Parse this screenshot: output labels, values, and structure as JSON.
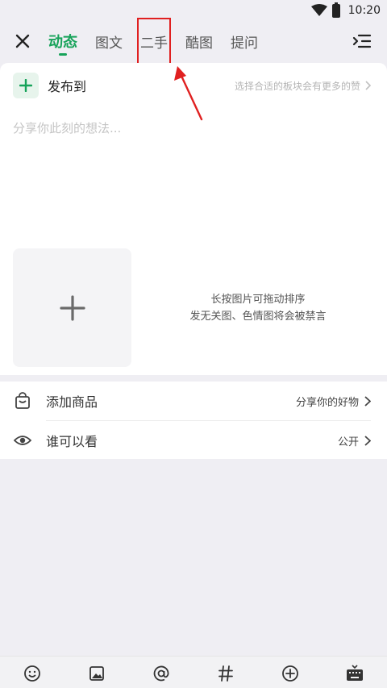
{
  "status_bar": {
    "time": "10:20"
  },
  "tabs": [
    {
      "label": "动态",
      "active": true
    },
    {
      "label": "图文",
      "active": false
    },
    {
      "label": "二手",
      "active": false,
      "highlighted": true
    },
    {
      "label": "酷图",
      "active": false
    },
    {
      "label": "提问",
      "active": false
    }
  ],
  "publish": {
    "label": "发布到",
    "hint": "选择合适的板块会有更多的赞"
  },
  "post": {
    "placeholder": "分享你此刻的想法..."
  },
  "image_hint": {
    "line1": "长按图片可拖动排序",
    "line2": "发无关图、色情图将会被禁言"
  },
  "options": {
    "add_goods": {
      "label": "添加商品",
      "value": "分享你的好物"
    },
    "visibility": {
      "label": "谁可以看",
      "value": "公开"
    }
  },
  "colors": {
    "accent": "#17a35a",
    "highlight": "#e02020",
    "background": "#efeef3"
  },
  "bottom_bar_icons": [
    "emoji-icon",
    "image-icon",
    "mention-icon",
    "hashtag-icon",
    "add-circle-icon",
    "keyboard-icon"
  ]
}
